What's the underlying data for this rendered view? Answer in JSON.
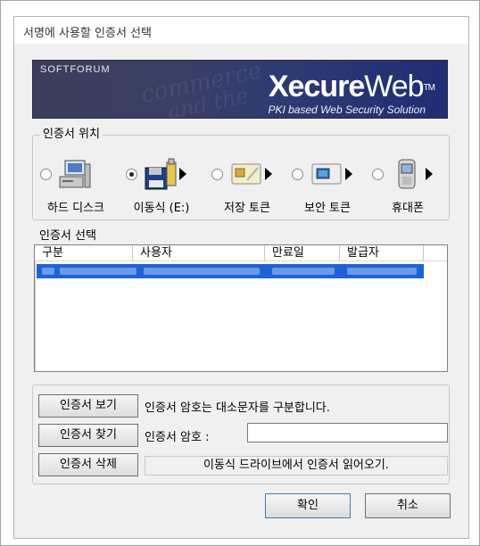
{
  "window": {
    "title": "서명에 사용할 인증서 선택"
  },
  "banner": {
    "brand_small": "SOFTFORUM",
    "brand_main_bold": "Xecure",
    "brand_main_light": "Web",
    "trademark": "TM",
    "tagline": "PKI based Web Security Solution",
    "watermark_1": "commerce",
    "watermark_2": "and the"
  },
  "location": {
    "title": "인증서 위치",
    "items": [
      {
        "label": "하드 디스크",
        "icon": "computer-icon",
        "selected": false,
        "has_arrow": false
      },
      {
        "label": "이동식 (E:)",
        "icon": "floppy-usb-icon",
        "selected": true,
        "has_arrow": true
      },
      {
        "label": "저장 토큰",
        "icon": "smart-card-icon",
        "selected": false,
        "has_arrow": true
      },
      {
        "label": "보안 토큰",
        "icon": "security-token-icon",
        "selected": false,
        "has_arrow": true
      },
      {
        "label": "휴대폰",
        "icon": "mobile-phone-icon",
        "selected": false,
        "has_arrow": true
      }
    ]
  },
  "cert_select": {
    "title": "인증서 선택",
    "columns": [
      "구분",
      "사용자",
      "만료일",
      "발급자"
    ]
  },
  "actions": {
    "view_button": "인증서 보기",
    "find_button": "인증서 찾기",
    "delete_button": "인증서 삭제",
    "password_notice": "인증서 암호는 대소문자를 구분합니다.",
    "password_label": "인증서 암호 :",
    "password_value": "",
    "status_text": "이동식 드라이브에서 인증서 읽어오기."
  },
  "footer": {
    "ok_button": "확인",
    "cancel_button": "취소"
  },
  "colors": {
    "selection": "#1e63d6",
    "banner_dark": "#2d3a72",
    "window_bg": "#f0f0f0"
  }
}
